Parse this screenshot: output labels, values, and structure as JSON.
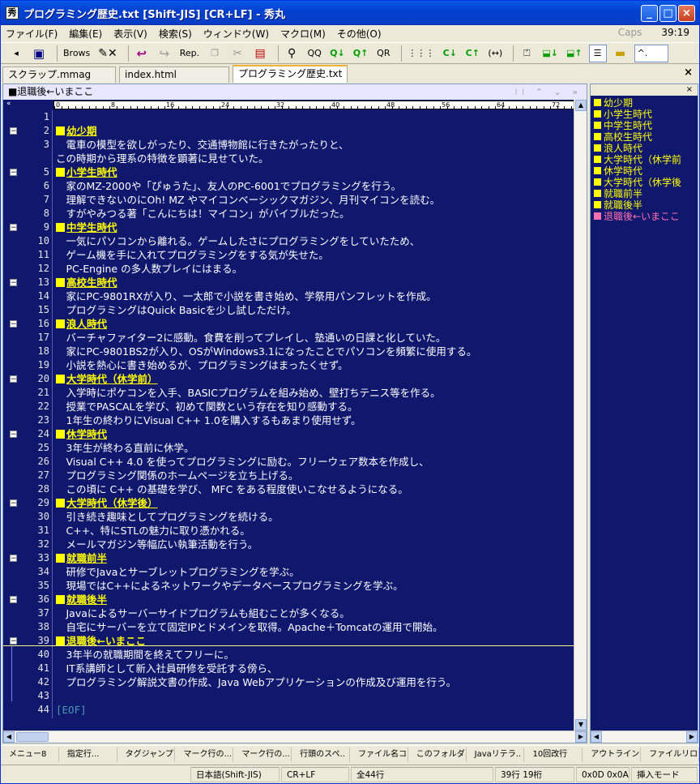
{
  "window": {
    "title": "プログラミング歴史.txt  [Shift-JIS] [CR+LF] - 秀丸",
    "app_icon_char": "秀",
    "controls": [
      "minimize",
      "maximize",
      "close"
    ]
  },
  "menu": {
    "items": [
      "ファイル(F)",
      "編集(E)",
      "表示(V)",
      "検索(S)",
      "ウィンドウ(W)",
      "マクロ(M)",
      "その他(O)"
    ],
    "caps": "Caps",
    "clock": "39:19"
  },
  "toolbar": {
    "save_label": "",
    "browse_label": "Brows",
    "replace_label": "Rep.",
    "search_labels": [
      "QQ",
      "Q↓",
      "Q↑",
      "QR"
    ],
    "nav_labels": [
      "⋮⋮⋮",
      "C↓",
      "C↑",
      "(↔)"
    ],
    "combo_value": "^.",
    "icons": [
      "save-icon",
      "pen-erase-icon",
      "undo-icon",
      "redo-icon",
      "copy-icon",
      "cut-icon",
      "paste-icon",
      "search-icon",
      "outline-icon",
      "folder-icon"
    ]
  },
  "tabs": [
    {
      "label": "スクラップ.mmag",
      "active": false
    },
    {
      "label": "index.html",
      "active": false
    },
    {
      "label": "プログラミング歴史.txt",
      "active": true
    }
  ],
  "editor": {
    "header": "■退職後←いまここ",
    "header_controls": "⁝⁝ ⌃ ⌄ »",
    "ruler_left": "«",
    "ruler_marks": [
      "0",
      "8",
      "16",
      "24",
      "32",
      "40",
      "48",
      "56",
      "64",
      "72"
    ],
    "lines": [
      {
        "n": "1",
        "text": "",
        "heading": false,
        "fold": false
      },
      {
        "n": "2",
        "text": "幼少期",
        "heading": true,
        "fold": true
      },
      {
        "n": "3",
        "text": "　電車の模型を欲しがったり、交通博物館に行きたがったりと、",
        "heading": false,
        "fold": false
      },
      {
        "n": "",
        "text": "この時期から理系の特徴を顕著に見せていた。",
        "heading": false,
        "fold": false
      },
      {
        "n": "5",
        "text": "小学生時代",
        "heading": true,
        "fold": true
      },
      {
        "n": "6",
        "text": "　家のMZ-2000や「ぴゅうた」、友人のPC-6001でプログラミングを行う。",
        "heading": false,
        "fold": false
      },
      {
        "n": "7",
        "text": "　理解できないのにOh! MZ やマイコンベーシックマガジン、月刊マイコンを読む。",
        "heading": false,
        "fold": false
      },
      {
        "n": "8",
        "text": "　すがやみつる著「こんにちは！マイコン」がバイブルだった。",
        "heading": false,
        "fold": false
      },
      {
        "n": "9",
        "text": "中学生時代",
        "heading": true,
        "fold": true
      },
      {
        "n": "10",
        "text": "　一気にパソコンから離れる。ゲームしたさにプログラミングをしていたため、",
        "heading": false,
        "fold": false
      },
      {
        "n": "11",
        "text": "　ゲーム機を手に入れてプログラミングをする気が失せた。",
        "heading": false,
        "fold": false
      },
      {
        "n": "12",
        "text": "　PC-Engine の多人数プレイにはまる。",
        "heading": false,
        "fold": false
      },
      {
        "n": "13",
        "text": "高校生時代",
        "heading": true,
        "fold": true
      },
      {
        "n": "14",
        "text": "　家にPC-9801RXが入り、一太郎で小説を書き始め、学祭用パンフレットを作成。",
        "heading": false,
        "fold": false
      },
      {
        "n": "15",
        "text": "　プログラミングはQuick Basicを少し試しただけ。",
        "heading": false,
        "fold": false
      },
      {
        "n": "16",
        "text": "浪人時代",
        "heading": true,
        "fold": true
      },
      {
        "n": "17",
        "text": "　バーチャファイター2に感動。食費を削ってプレイし、塾通いの日課と化していた。",
        "heading": false,
        "fold": false
      },
      {
        "n": "18",
        "text": "　家にPC-9801BS2が入り、OSがWindows3.1になったことでパソコンを頻繁に使用する。",
        "heading": false,
        "fold": false
      },
      {
        "n": "19",
        "text": "　小説を熱心に書き始めるが、プログラミングはまったくせず。",
        "heading": false,
        "fold": false
      },
      {
        "n": "20",
        "text": "大学時代（休学前）",
        "heading": true,
        "fold": true
      },
      {
        "n": "21",
        "text": "　入学時にポケコンを入手、BASICプログラムを組み始め、壁打ちテニス等を作る。",
        "heading": false,
        "fold": false
      },
      {
        "n": "22",
        "text": "　授業でPASCALを学び、初めて関数という存在を知り感動する。",
        "heading": false,
        "fold": false
      },
      {
        "n": "23",
        "text": "　1年生の終わりにVisual C++ 1.0を購入するもあまり使用せず。",
        "heading": false,
        "fold": false
      },
      {
        "n": "24",
        "text": "休学時代",
        "heading": true,
        "fold": true
      },
      {
        "n": "25",
        "text": "　3年生が終わる直前に休学。",
        "heading": false,
        "fold": false
      },
      {
        "n": "26",
        "text": "　Visual C++ 4.0 を使ってプログラミングに励む。フリーウェア数本を作成し、",
        "heading": false,
        "fold": false
      },
      {
        "n": "27",
        "text": "　プログラミング関係のホームページを立ち上げる。",
        "heading": false,
        "fold": false
      },
      {
        "n": "28",
        "text": "　この頃に C++ の基礎を学び、 MFC をある程度使いこなせるようになる。",
        "heading": false,
        "fold": false
      },
      {
        "n": "29",
        "text": "大学時代（休学後）",
        "heading": true,
        "fold": true
      },
      {
        "n": "30",
        "text": "　引き続き趣味としてプログラミングを続ける。",
        "heading": false,
        "fold": false
      },
      {
        "n": "31",
        "text": "　C++、特にSTLの魅力に取り憑かれる。",
        "heading": false,
        "fold": false
      },
      {
        "n": "32",
        "text": "　メールマガジン等幅広い執筆活動を行う。",
        "heading": false,
        "fold": false
      },
      {
        "n": "33",
        "text": "就職前半",
        "heading": true,
        "fold": true
      },
      {
        "n": "34",
        "text": "　研修でJavaとサーブレットプログラミングを学ぶ。",
        "heading": false,
        "fold": false
      },
      {
        "n": "35",
        "text": "　現場ではC++によるネットワークやデータベースプログラミングを学ぶ。",
        "heading": false,
        "fold": false
      },
      {
        "n": "36",
        "text": "就職後半",
        "heading": true,
        "fold": true
      },
      {
        "n": "37",
        "text": "　Javaによるサーバーサイドプログラムも組むことが多くなる。",
        "heading": false,
        "fold": false
      },
      {
        "n": "38",
        "text": "　自宅にサーバーを立て固定IPとドメインを取得。Apache＋Tomcatの運用で開始。",
        "heading": false,
        "fold": false
      },
      {
        "n": "39",
        "text": "退職後←いまここ",
        "heading": true,
        "fold": true
      },
      {
        "n": "40",
        "text": "　3年半の就職期間を終えてフリーに。",
        "heading": false,
        "fold": false
      },
      {
        "n": "41",
        "text": "　IT系講師として新入社員研修を受託する傍ら、",
        "heading": false,
        "fold": false
      },
      {
        "n": "42",
        "text": "　プログラミング解説文書の作成、Java Webアプリケーションの作成及び運用を行う。",
        "heading": false,
        "fold": false
      },
      {
        "n": "43",
        "text": "",
        "heading": false,
        "fold": false
      },
      {
        "n": "44",
        "text": "[EOF]",
        "heading": false,
        "fold": false
      }
    ]
  },
  "outline": {
    "close_label": "×",
    "items": [
      {
        "label": "幼少期",
        "current": false
      },
      {
        "label": "小学生時代",
        "current": false
      },
      {
        "label": "中学生時代",
        "current": false
      },
      {
        "label": "高校生時代",
        "current": false
      },
      {
        "label": "浪人時代",
        "current": false
      },
      {
        "label": "大学時代（休学前",
        "current": false
      },
      {
        "label": "休学時代",
        "current": false
      },
      {
        "label": "大学時代（休学後",
        "current": false
      },
      {
        "label": "就職前半",
        "current": false
      },
      {
        "label": "就職後半",
        "current": false
      },
      {
        "label": "退職後←いまここ",
        "current": true
      }
    ]
  },
  "fkeys": [
    "メニュー8",
    "指定行...",
    "タグジャンプ",
    "マーク行の...",
    "マーク行の...",
    "行頭のスペ..",
    "ファイル名コ..",
    "このフォルダ..",
    "Javaリテラ..",
    "10回改行",
    "アウトライン..",
    "ファイルリロード"
  ],
  "status": {
    "encoding": "日本語(Shift-JIS)",
    "newline": "CR+LF",
    "total_lines": "全44行",
    "position": "39行 19桁",
    "char_code": "0x0D 0x0A",
    "mode": "挿入モード"
  },
  "colors": {
    "editor_bg": "#10186e",
    "text": "#ffffff",
    "heading": "#ffff00",
    "current_outline": "#ff70b0",
    "eof": "#4a9ab0"
  }
}
